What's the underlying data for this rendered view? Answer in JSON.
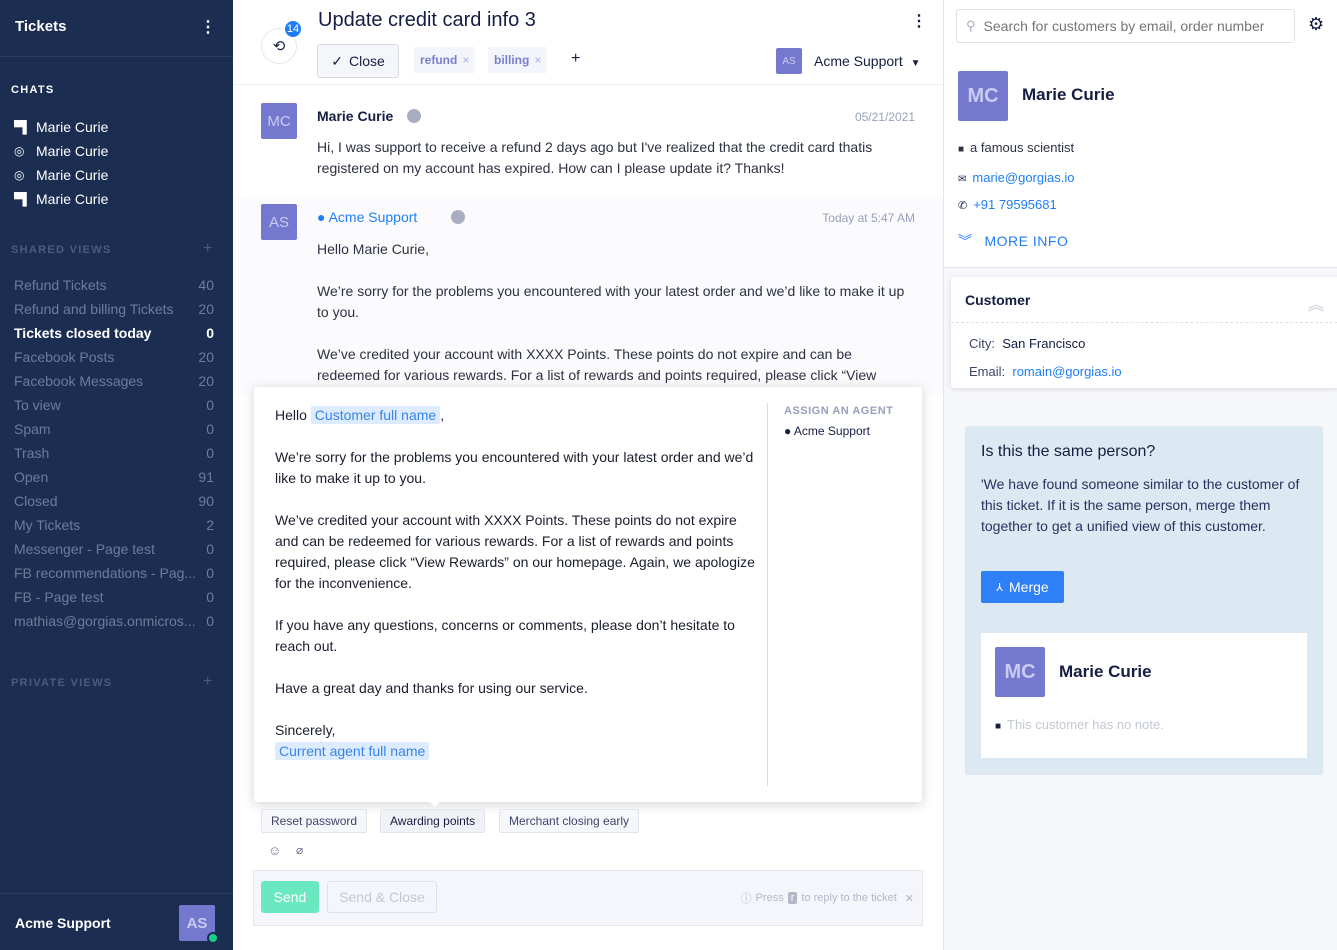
{
  "sidebar": {
    "title": "Tickets",
    "menu_icon": "kebab-icon",
    "chats_label": "CHATS",
    "chats": [
      {
        "name": "Marie Curie",
        "icon": "chat-icon"
      },
      {
        "name": "Marie Curie",
        "icon": "messenger-icon"
      },
      {
        "name": "Marie Curie",
        "icon": "messenger-icon"
      },
      {
        "name": "Marie Curie",
        "icon": "chat-icon"
      }
    ],
    "shared_label": "SHARED VIEWS",
    "private_label": "PRIVATE VIEWS",
    "views": [
      {
        "label": "Refund Tickets",
        "count": "40"
      },
      {
        "label": "Refund and billing Tickets",
        "count": "20"
      },
      {
        "label": "Tickets closed today",
        "count": "0",
        "active": true
      },
      {
        "label": "Facebook Posts",
        "count": "20"
      },
      {
        "label": "Facebook Messages",
        "count": "20"
      },
      {
        "label": "To view",
        "count": "0"
      },
      {
        "label": "Spam",
        "count": "0"
      },
      {
        "label": "Trash",
        "count": "0"
      },
      {
        "label": "Open",
        "count": "91"
      },
      {
        "label": "Closed",
        "count": "90"
      },
      {
        "label": "My Tickets",
        "count": "2"
      },
      {
        "label": "Messenger - Page test",
        "count": "0"
      },
      {
        "label": "FB recommendations - Pag...",
        "count": "0"
      },
      {
        "label": "FB - Page test",
        "count": "0"
      },
      {
        "label": "mathias@gorgias.onmicros...",
        "count": "0"
      }
    ],
    "user": {
      "name": "Acme Support",
      "initials": "AS",
      "status_color": "#18cc8c"
    }
  },
  "ticket": {
    "history_count": "14",
    "title": "Update credit card info 3",
    "close_label": "Close",
    "tags": [
      "refund",
      "billing"
    ],
    "add_tag": "+",
    "assignee_initials": "AS",
    "assignee": "Acme Support"
  },
  "messages": [
    {
      "initials": "MC",
      "author": "Marie Curie",
      "date": "05/21/2021",
      "body": "Hi, I was support to receive a refund 2 days ago but I've realized that the credit card thatis registered on my account has expired. How can I please update it? Thanks!"
    },
    {
      "initials": "AS",
      "author": "Acme Support",
      "date": "Today at 5:47 AM",
      "p1": "Hello Marie Curie,",
      "p2": "We’re sorry for the problems you encountered with your latest order and we’d like to make it up to you.",
      "p3": "We’ve credited your account with XXXX Points. These points do not expire and can be redeemed for various rewards. For a list of rewards and points required, please click “View"
    }
  ],
  "macro_preview": {
    "hello": "Hello",
    "customer_var": "Customer full name",
    "comma": ",",
    "p1": "We’re sorry for the problems you encountered with your latest order and we’d like to make it up to you.",
    "p2": "We’ve credited your account with XXXX Points. These points do not expire and can be redeemed for various rewards. For a list of rewards and points required, please click “View Rewards” on our homepage. Again, we apologize for the inconvenience.",
    "p3": "If you have any questions, concerns or comments, please don’t hesitate to reach out.",
    "p4": "Have a great day and thanks for using our service.",
    "sign": "Sincerely,",
    "agent_var": "Current agent full name",
    "assign_label": "ASSIGN AN AGENT",
    "assign_agent": "Acme Support"
  },
  "macros": [
    "Reset password",
    "Awarding points",
    "Merchant closing early"
  ],
  "composer": {
    "send": "Send",
    "send_close": "Send & Close",
    "hint_press": "Press",
    "hint_key": "r",
    "hint_rest": "to reply to the ticket"
  },
  "customer": {
    "search_placeholder": "Search for customers by email, order number",
    "initials": "MC",
    "name": "Marie Curie",
    "note": "a famous scientist",
    "email": "marie@gorgias.io",
    "phone": "+91 79595681",
    "more_info": "MORE INFO",
    "widget": {
      "title": "Customer",
      "city_label": "City:",
      "city": "San Francisco",
      "email_label": "Email:",
      "email": "romain@gorgias.io"
    }
  },
  "merge": {
    "title": "Is this the same person?",
    "text": "'We have found someone similar to the customer of this ticket. If it is the same person, merge them together to get a unified view of this customer.",
    "button": "Merge",
    "initials": "MC",
    "name": "Marie Curie",
    "note": "This customer has no note."
  }
}
